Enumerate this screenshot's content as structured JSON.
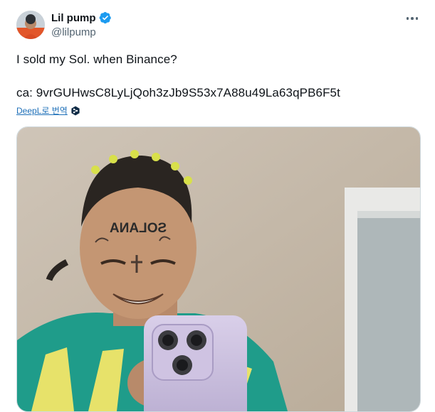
{
  "author": {
    "display_name": "Lil pump",
    "handle": "@lilpump",
    "verified": true,
    "avatar_icon": "profile-photo"
  },
  "post": {
    "line1": "I sold my Sol. when Binance?",
    "line2": "ca: 9vrGUHwsC8LyLjQoh3zJb9S53x7A88u49La63qPB6F5t"
  },
  "translate": {
    "label": "DeepL로 번역",
    "icon": "deepl-icon"
  },
  "more_icon": "more-options-icon",
  "media": {
    "forehead_tattoo": "SOLANA",
    "description_icon": "selfie-photo"
  },
  "colors": {
    "accent": "#1d9bf0",
    "text": "#0f1419",
    "muted": "#536471"
  }
}
